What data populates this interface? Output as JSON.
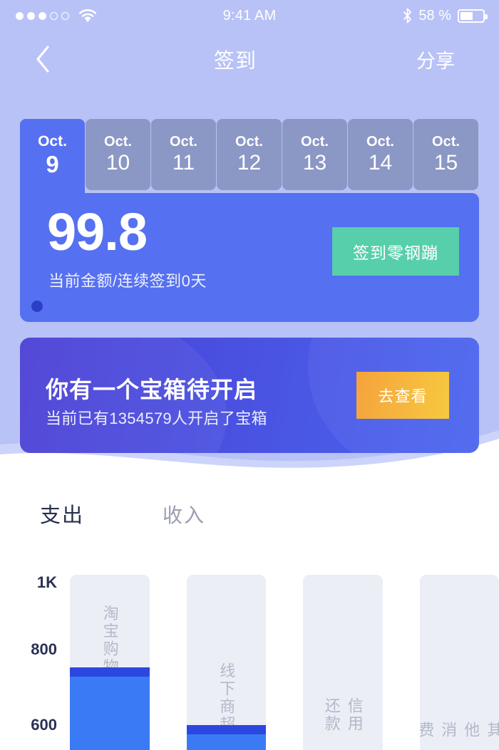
{
  "status_bar": {
    "signal_filled": 3,
    "signal_hollow": 2,
    "wifi_icon": "wifi-icon",
    "time": "9:41 AM",
    "bluetooth_icon": "bluetooth-icon",
    "battery_percent": "58 %",
    "battery_level": 58
  },
  "navbar": {
    "back_icon": "chevron-left-icon",
    "title": "签到",
    "action": "分享"
  },
  "signin": {
    "dates": [
      {
        "month": "Oct.",
        "day": "9",
        "active": true
      },
      {
        "month": "Oct.",
        "day": "10",
        "active": false
      },
      {
        "month": "Oct.",
        "day": "11",
        "active": false
      },
      {
        "month": "Oct.",
        "day": "12",
        "active": false
      },
      {
        "month": "Oct.",
        "day": "13",
        "active": false
      },
      {
        "month": "Oct.",
        "day": "14",
        "active": false
      },
      {
        "month": "Oct.",
        "day": "15",
        "active": false
      }
    ],
    "amount": "99.8",
    "amount_caption": "当前金额/连续签到0天",
    "action_button": "签到零钢蹦",
    "pager_dots": 1
  },
  "treasure": {
    "title": "你有一个宝箱待开启",
    "subtitle": "当前已有1354579人开启了宝箱",
    "button": "去查看"
  },
  "section_tabs": [
    {
      "label": "支出",
      "active": true
    },
    {
      "label": "收入",
      "active": false
    }
  ],
  "colors": {
    "lavender_bg": "#b8c2f7",
    "card_blue": "#5570f0",
    "tab_inactive": "#8b97c4",
    "banner_purple": "#4b3fd4",
    "banner_blue": "#4a66ef",
    "green_accent": "#57cfab",
    "orange_accent": "#f5a33c",
    "orange_accent2": "#f6c93f",
    "bar_fill": "#3a7af5",
    "bar_cap": "#2c47e0",
    "bar_track": "#eceef6",
    "pager_dot": "#2b3ec7"
  },
  "chart_data": {
    "type": "bar",
    "title": "",
    "xlabel": "",
    "ylabel": "",
    "categories": [
      "淘宝购物",
      "线下商超",
      "信用还款",
      "其他消费"
    ],
    "values": [
      760,
      600,
      0,
      0
    ],
    "ytick_labels": [
      "1K",
      "800",
      "600"
    ],
    "ytick_values": [
      1000,
      800,
      600
    ],
    "ylim": [
      430,
      1030
    ],
    "grid": false,
    "legend": "none",
    "note": "bars are vertical tracks; fill height encodes spending amount"
  }
}
